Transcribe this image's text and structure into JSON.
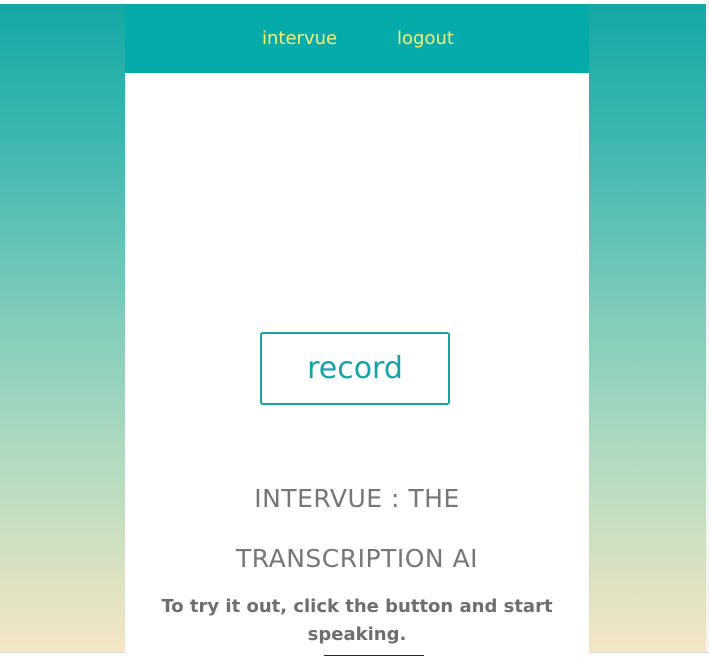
{
  "nav": {
    "links": [
      "intervue",
      "logout"
    ]
  },
  "main": {
    "record_button_label": "record",
    "headline_line1": "INTERVUE : THE",
    "headline_line2": "TRANSCRIPTION AI",
    "subtitle": "To try it out, click the button and start speaking."
  },
  "colors": {
    "navbar": "#04aba9",
    "nav_link": "#f5ef78",
    "button_accent": "#15a3a3",
    "headline_text": "#767676",
    "background_top": "#12a8a6",
    "background_bottom": "#f7e6c4"
  }
}
